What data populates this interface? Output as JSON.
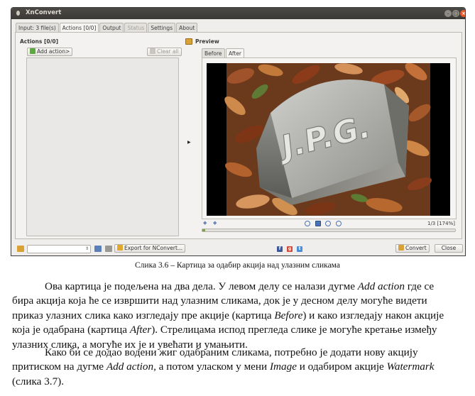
{
  "window": {
    "title": "XnConvert",
    "controls": {
      "minimize": "–",
      "maximize": "□",
      "close": "×"
    }
  },
  "tabs": [
    {
      "label": "Input: 3 file(s)",
      "state": "normal"
    },
    {
      "label": "Actions [0/0]",
      "state": "active"
    },
    {
      "label": "Output",
      "state": "normal"
    },
    {
      "label": "Status",
      "state": "disabled"
    },
    {
      "label": "Settings",
      "state": "normal"
    },
    {
      "label": "About",
      "state": "normal"
    }
  ],
  "actions_panel": {
    "title": "Actions [0/0]",
    "add_button": "Add action>",
    "clear_button": "Clear all",
    "splitter_arrow": "▶"
  },
  "preview": {
    "title": "Preview",
    "tabs": [
      "Before",
      "After"
    ],
    "active_tab": "After",
    "image_text": "J.P.G.",
    "zoom_info": "1/3 [174%]",
    "progress": 0.01,
    "nav_icons": [
      "prev-icon",
      "next-icon"
    ],
    "zoom_icons": [
      "zoom-in-icon",
      "fit-icon",
      "zoom-icon",
      "zoom-out-icon"
    ]
  },
  "bottom_bar": {
    "preset_value": "",
    "export_button": "Export for NConvert...",
    "convert_button": "Convert",
    "close_button": "Close",
    "social_icons": [
      "facebook-icon",
      "google-plus-icon",
      "twitter-icon"
    ]
  },
  "document": {
    "caption": "Слика 3.6 – Картица за одабир акција над улазним сликама",
    "paragraph1": [
      [
        {
          "t": "Ова картица је подељена на два дела. У левом делу се налази дугме "
        },
        {
          "t": "Add action",
          "i": true
        },
        {
          "t": " где се"
        }
      ],
      [
        {
          "t": "бира акција која ће се извршити над улазним сликама, док је у десном делу могуће видети"
        }
      ],
      [
        {
          "t": "приказ улазних слика како изгледају пре акције (картица "
        },
        {
          "t": "Before",
          "i": true
        },
        {
          "t": ") и како изгледају након акције"
        }
      ],
      [
        {
          "t": "која је одабрана (картица "
        },
        {
          "t": "After",
          "i": true
        },
        {
          "t": "). Стрелицама испод прегледа слике је могуће кретање између"
        }
      ],
      [
        {
          "t": "улазних слика, а могуће их је и увећати и умањити."
        }
      ]
    ],
    "paragraph2": [
      [
        {
          "t": "Како би се додао водени жиг одабраним сликама, потребно је додати нову акцију"
        }
      ],
      [
        {
          "t": "притиском на дугме "
        },
        {
          "t": "Add action",
          "i": true
        },
        {
          "t": ", а потом уласком у мени "
        },
        {
          "t": "Image",
          "i": true
        },
        {
          "t": " и одабиром акције "
        },
        {
          "t": "Watermark",
          "i": true
        }
      ],
      [
        {
          "t": "(слика 3.7)."
        }
      ]
    ]
  },
  "colors": {
    "titlebar": "#3c3b37",
    "close_button": "#e9592b",
    "progress_fill": "#7ba344",
    "icon_blue": "#4a73b3"
  }
}
